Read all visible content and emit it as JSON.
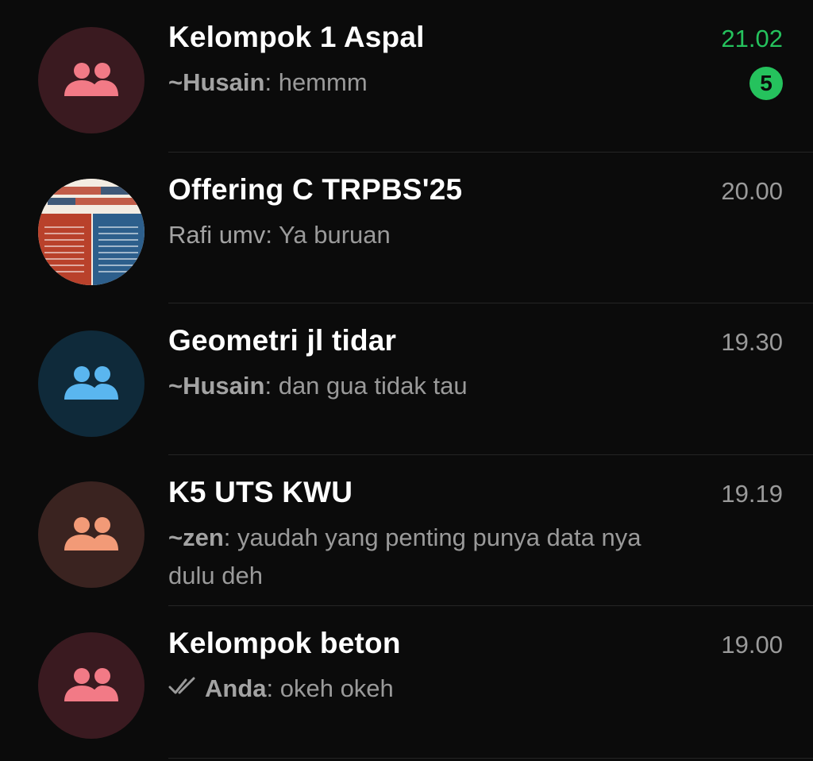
{
  "chats": [
    {
      "title": "Kelompok 1 Aspal",
      "sender": "~Husain",
      "message": "hemmm",
      "time": "21.02",
      "unread_count": "5",
      "avatar_icon": "group-icon",
      "avatar_bg": "#3a1a20",
      "avatar_fg": "#f27a86"
    },
    {
      "title": "Offering C TRPBS'25",
      "sender": "Rafi umv",
      "message": "Ya buruan",
      "time": "20.00",
      "avatar_icon": "group-photo"
    },
    {
      "title": "Geometri jl tidar",
      "sender": "~Husain",
      "message": "dan gua tidak tau",
      "time": "19.30",
      "avatar_icon": "group-icon",
      "avatar_bg": "#0f2a3a",
      "avatar_fg": "#5ab6ef"
    },
    {
      "title": "K5 UTS KWU",
      "sender": "~zen",
      "message": "yaudah yang penting punya data nya dulu deh",
      "time": "19.19",
      "avatar_icon": "group-icon",
      "avatar_bg": "#3a2320",
      "avatar_fg": "#f29a77"
    },
    {
      "title": "Kelompok beton",
      "sender": "Anda",
      "message": "okeh okeh",
      "time": "19.00",
      "status_icon": "double-check-icon",
      "avatar_icon": "group-icon",
      "avatar_bg": "#3a1a20",
      "avatar_fg": "#f27a86"
    }
  ],
  "colors": {
    "background": "#0b0b0b",
    "unread_accent": "#25c25d",
    "secondary_text": "#9a9a9a"
  }
}
